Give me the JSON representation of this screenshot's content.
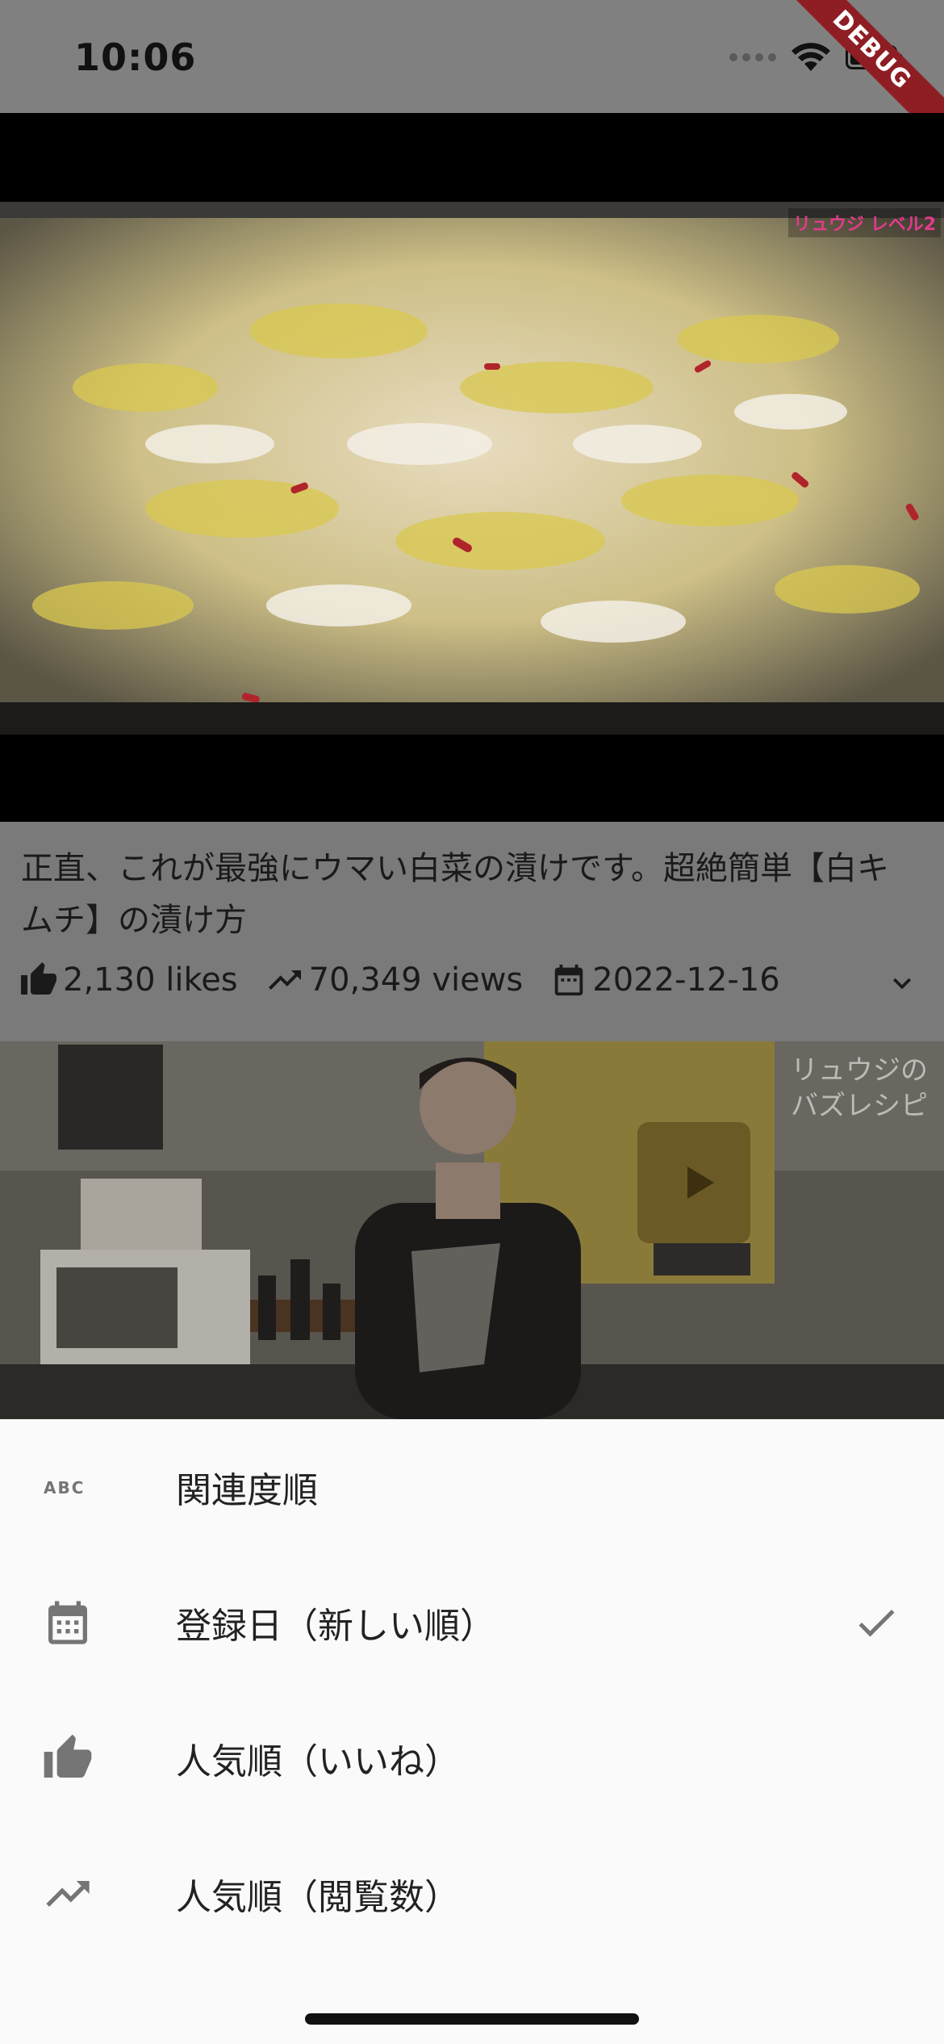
{
  "status_bar": {
    "time": "10:06",
    "icons": [
      "signal-icon",
      "wifi-icon",
      "battery-icon"
    ]
  },
  "debug_banner": "DEBUG",
  "video": {
    "overlay_text": "リュウジ レベル2",
    "title": "正直、これが最強にウマい白菜の漬けです。超絶簡単【白キムチ】の漬け方",
    "likes": "2,130 likes",
    "views": "70,349 views",
    "date": "2022-12-16"
  },
  "next_video": {
    "watermark_line1": "リュウジの",
    "watermark_line2": "バズレシピ"
  },
  "sort_sheet": {
    "items": [
      {
        "label": "関連度順",
        "icon": "abc-icon",
        "selected": false
      },
      {
        "label": "登録日（新しい順）",
        "icon": "calendar-icon",
        "selected": true
      },
      {
        "label": "人気順（いいね）",
        "icon": "thumb-up-icon",
        "selected": false
      },
      {
        "label": "人気順（閲覧数）",
        "icon": "trending-up-icon",
        "selected": false
      }
    ]
  },
  "colors": {
    "scrim": "#808080",
    "sheet_bg": "#fafafa",
    "icon_gray": "#757575",
    "debug_red": "#8e1e24"
  }
}
